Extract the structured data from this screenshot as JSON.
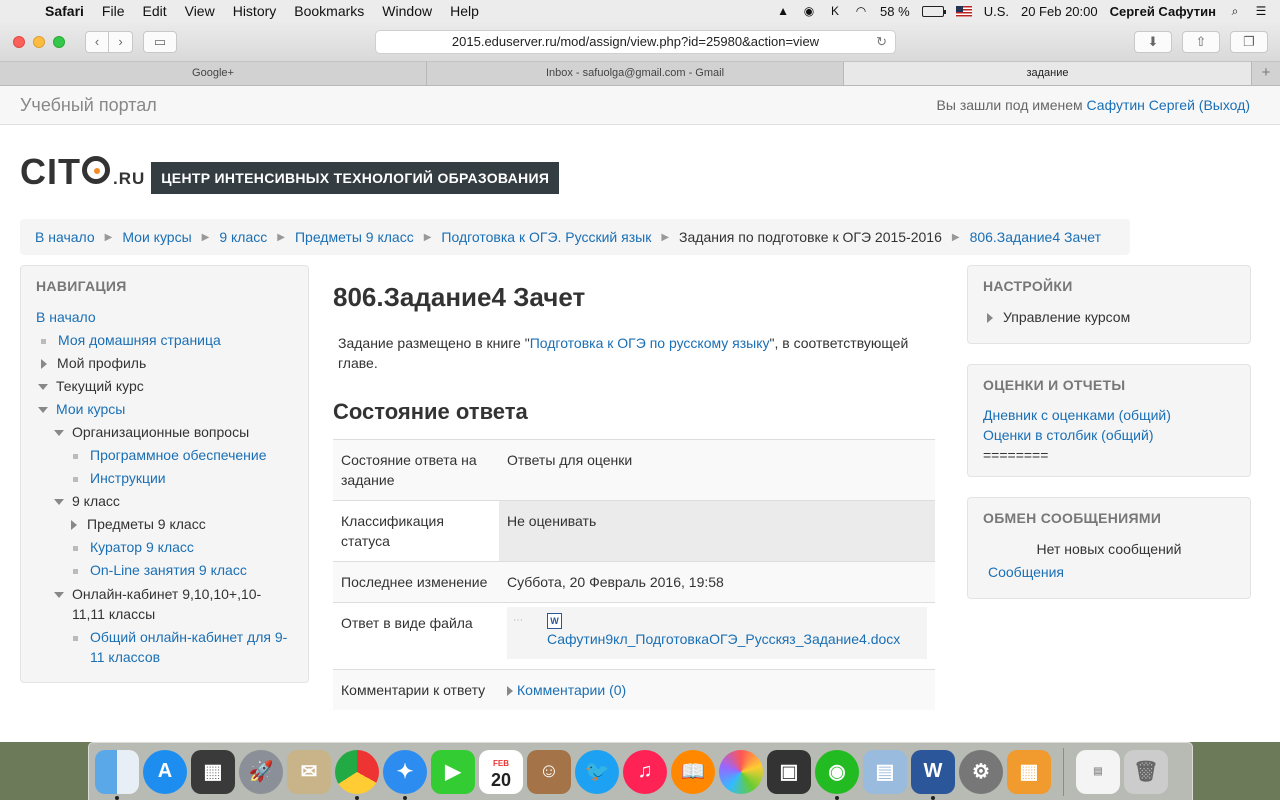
{
  "menubar": {
    "app": "Safari",
    "items": [
      "File",
      "Edit",
      "View",
      "History",
      "Bookmarks",
      "Window",
      "Help"
    ],
    "battery": "58 %",
    "input_source": "U.S.",
    "datetime": "20 Feb  20:00",
    "user": "Сергей Сафутин"
  },
  "browser": {
    "url": "2015.eduserver.ru/mod/assign/view.php?id=25980&action=view",
    "tabs": [
      "Google+",
      "Inbox - safuolga@gmail.com - Gmail",
      "задание"
    ],
    "new_tab": "+"
  },
  "page": {
    "site_name": "Учебный портал",
    "login_prefix": "Вы зашли под именем",
    "login_user": "Сафутин Сергей",
    "login_logout": "(Выход)",
    "logo_text": "CIT",
    "logo_ru": ".RU",
    "logo_banner": "ЦЕНТР ИНТЕНСИВНЫХ ТЕХНОЛОГИЙ ОБРАЗОВАНИЯ",
    "breadcrumb": [
      "В начало",
      "Мои курсы",
      "9 класс",
      "Предметы 9 класс",
      "Подготовка к ОГЭ. Русский язык",
      "Задания по подготовке к ОГЭ 2015-2016",
      "806.Задание4 Зачет"
    ]
  },
  "navigation": {
    "title": "НАВИГАЦИЯ",
    "home": "В начало",
    "my_home": "Моя домашняя страница",
    "my_profile": "Мой профиль",
    "current_course": "Текущий курс",
    "my_courses": "Мои курсы",
    "org_questions": "Организационные вопросы",
    "software": "Программное обеспечение",
    "instructions": "Инструкции",
    "grade9": "9 класс",
    "subjects9": "Предметы 9 класс",
    "curator9": "Куратор 9 класс",
    "online9": "On-Line занятия 9 класс",
    "online_cabinet_line1": "Онлайн-кабинет 9,10,10+,10-",
    "online_cabinet_line2": "11,11 классы",
    "common_cabinet_line1": "Общий онлайн-кабинет для 9-",
    "common_cabinet_line2": "11 классов"
  },
  "main": {
    "title": "806.Задание4 Зачет",
    "intro_prefix": "Задание размещено в книге \"",
    "intro_link": "Подготовка к ОГЭ по русскому языку",
    "intro_suffix_line1": "\", в соответствующей",
    "intro_suffix_line2": "главе.",
    "status_heading": "Состояние ответа",
    "rows": {
      "r1_label_line1": "Состояние ответа на",
      "r1_label_line2": "задание",
      "r1_value": "Ответы для оценки",
      "r2_label_line1": "Классификация",
      "r2_label_line2": "статуса",
      "r2_value": "Не оценивать",
      "r3_label": "Последнее изменение",
      "r3_value": "Суббота, 20 Февраль 2016, 19:58",
      "r4_label": "Ответ в виде файла",
      "r4_file": "Сафутин9кл_ПодготовкаОГЭ_Русскяз_Задание4.docx",
      "r5_label": "Комментарии к ответу",
      "r5_value": "Комментарии (0)"
    }
  },
  "settings_block": {
    "title": "НАСТРОЙКИ",
    "item": "Управление курсом"
  },
  "grades_block": {
    "title": "ОЦЕНКИ И ОТЧЕТЫ",
    "link1": "Дневник с оценками (общий)",
    "link2": "Оценки в столбик (общий)",
    "divider": "========"
  },
  "messages_block": {
    "title": "ОБМЕН СООБЩЕНИЯМИ",
    "empty": "Нет новых сообщений",
    "link": "Сообщения"
  },
  "dock": {
    "calendar_month": "FEB",
    "calendar_day": "20"
  }
}
